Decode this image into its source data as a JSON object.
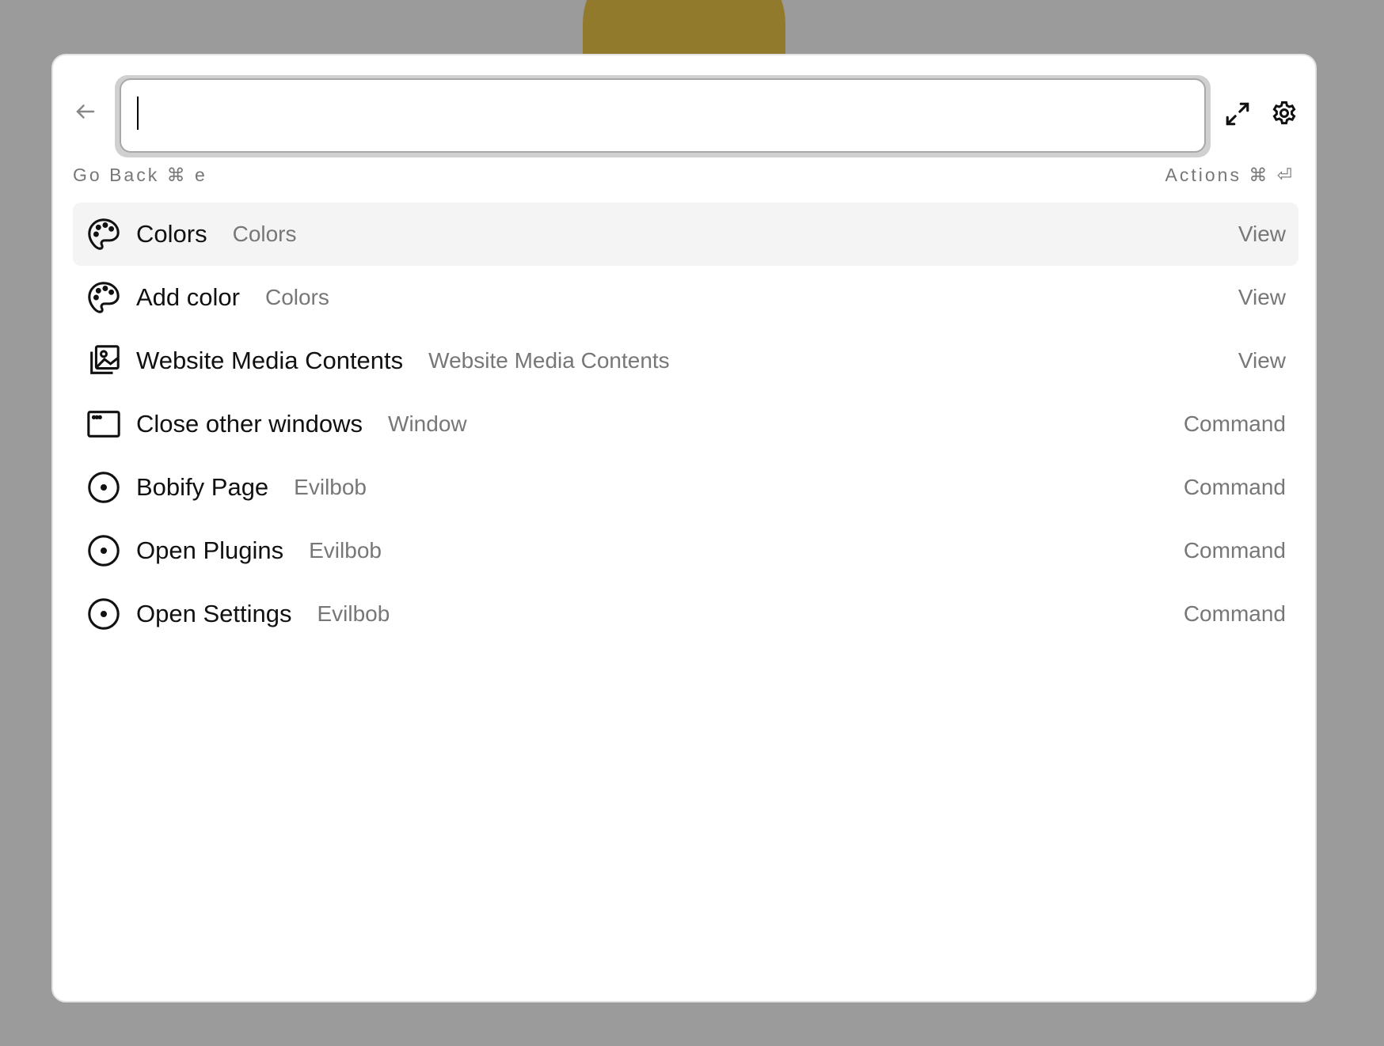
{
  "search": {
    "value": "",
    "placeholder": ""
  },
  "hints": {
    "go_back": "Go Back ⌘ e",
    "actions": "Actions ⌘ ⏎"
  },
  "items": [
    {
      "title": "Colors",
      "subtitle": "Colors",
      "type": "View",
      "icon": "palette-icon"
    },
    {
      "title": "Add color",
      "subtitle": "Colors",
      "type": "View",
      "icon": "palette-icon"
    },
    {
      "title": "Website Media Contents",
      "subtitle": "Website Media Contents",
      "type": "View",
      "icon": "images-icon"
    },
    {
      "title": "Close other windows",
      "subtitle": "Window",
      "type": "Command",
      "icon": "window-icon"
    },
    {
      "title": "Bobify Page",
      "subtitle": "Evilbob",
      "type": "Command",
      "icon": "circle-dot-icon"
    },
    {
      "title": "Open Plugins",
      "subtitle": "Evilbob",
      "type": "Command",
      "icon": "circle-dot-icon"
    },
    {
      "title": "Open Settings",
      "subtitle": "Evilbob",
      "type": "Command",
      "icon": "circle-dot-icon"
    }
  ]
}
